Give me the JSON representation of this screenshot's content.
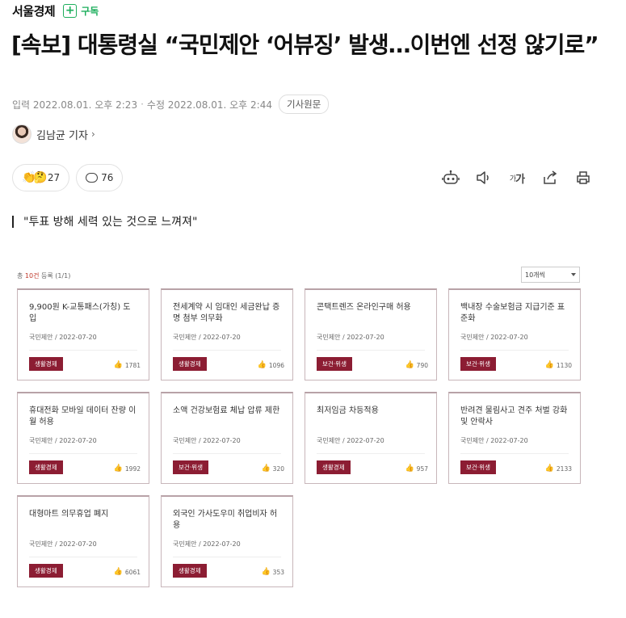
{
  "header": {
    "press_name": "서울경제",
    "subscribe_label": "구독"
  },
  "article": {
    "headline": "[속보] 대통령실 “국민제안 ‘어뷰징’ 발생…이번엔 선정 않기로”",
    "published": "입력 2022.08.01. 오후 2:23",
    "updated": "수정 2022.08.01. 오후 2:44",
    "original_button": "기사원문",
    "author": "김남균 기자",
    "reaction_count": "27",
    "comment_count": "76",
    "quote": "\"투표 방해 세력 있는 것으로 느껴져\""
  },
  "tools": {
    "font_label_small": "가",
    "font_label_big": "가"
  },
  "list": {
    "summary_prefix": "총 ",
    "summary_count": "10건",
    "summary_suffix": " 등록 (1/1)",
    "per_page": "10개씩"
  },
  "cards": [
    {
      "title": "9,900원 K-교통패스(가칭) 도입",
      "meta": "국민제안 / 2022-07-20",
      "tag": "생활경제",
      "likes": "1781"
    },
    {
      "title": "전세계약 시 임대인 세금완납 증명 첨부 의무화",
      "meta": "국민제안 / 2022-07-20",
      "tag": "생활경제",
      "likes": "1096"
    },
    {
      "title": "콘택트렌즈 온라인구매 허용",
      "meta": "국민제안 / 2022-07-20",
      "tag": "보건·위생",
      "likes": "790"
    },
    {
      "title": "백내장 수술보험금 지급기준 표준화",
      "meta": "국민제안 / 2022-07-20",
      "tag": "보건·위생",
      "likes": "1130"
    },
    {
      "title": "휴대전화 모바일 데이터 잔량 이월 허용",
      "meta": "국민제안 / 2022-07-20",
      "tag": "생활경제",
      "likes": "1992"
    },
    {
      "title": "소액 건강보험료 체납 압류 제한",
      "meta": "국민제안 / 2022-07-20",
      "tag": "보건·위생",
      "likes": "320"
    },
    {
      "title": "최저임금 차등적용",
      "meta": "국민제안 / 2022-07-20",
      "tag": "생활경제",
      "likes": "957"
    },
    {
      "title": "반려견 물림사고 견주 처벌 강화 및 안락사",
      "meta": "국민제안 / 2022-07-20",
      "tag": "보건·위생",
      "likes": "2133"
    },
    {
      "title": "대형마트 의무휴업 폐지",
      "meta": "국민제안 / 2022-07-20",
      "tag": "생활경제",
      "likes": "6061"
    },
    {
      "title": "외국인 가사도우미 취업비자 허용",
      "meta": "국민제안 / 2022-07-20",
      "tag": "생활경제",
      "likes": "353"
    }
  ],
  "icons": {
    "subscribe": "plus-icon",
    "reaction": "clap-emoji-icon",
    "comment": "speech-bubble-icon",
    "tts": "robot-icon",
    "audio": "speaker-icon",
    "font": "font-size-icon",
    "share": "share-icon",
    "print": "print-icon",
    "like": "thumbs-up-icon"
  },
  "colors": {
    "accent_green": "#1dae5c",
    "tag_red": "#8c1d33",
    "card_border": "#c8b6ba"
  }
}
